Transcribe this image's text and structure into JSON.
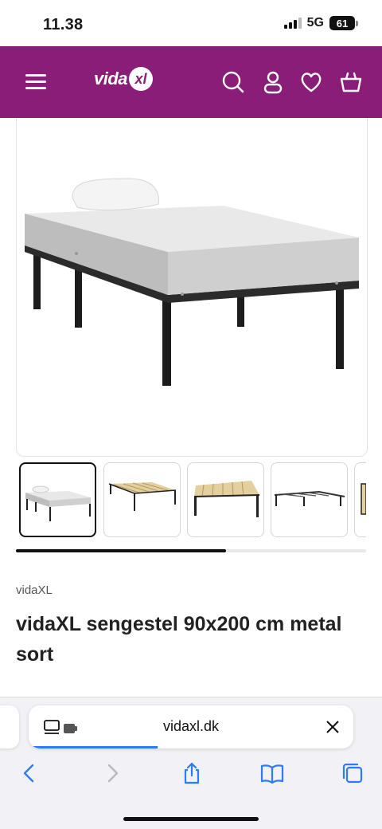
{
  "status_bar": {
    "time": "11.38",
    "network": "5G",
    "battery": "61"
  },
  "header": {
    "logo_text": "vida",
    "logo_badge": "xl",
    "brand_color": "#8a1d78",
    "icons": [
      "menu-icon",
      "search-icon",
      "account-icon",
      "wishlist-heart-icon",
      "cart-icon"
    ]
  },
  "gallery": {
    "thumbnails": [
      "bed-with-mattress",
      "slatted-frame-angle",
      "slatted-frame-front",
      "frame-side",
      "frame-partial"
    ],
    "active_index": 0,
    "scroll_progress": 0.6
  },
  "product": {
    "brand": "vidaXL",
    "title": "vidaXL sengestel 90x200 cm metal sort"
  },
  "browser": {
    "url": "vidaxl.dk",
    "accent_color": "#2f7bf6",
    "toolbar_icons": [
      "back-icon",
      "forward-icon",
      "share-icon",
      "bookmarks-icon",
      "tabs-icon"
    ]
  }
}
